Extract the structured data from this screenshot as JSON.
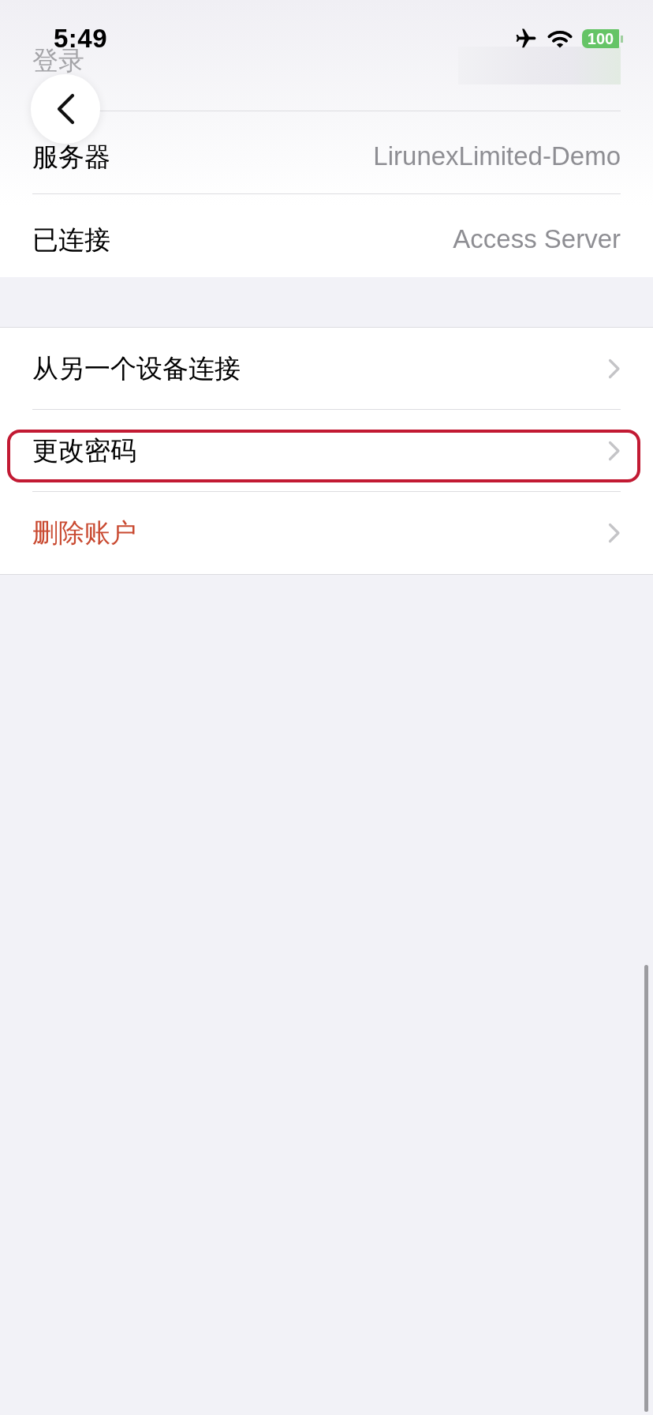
{
  "status_bar": {
    "time": "5:49",
    "airplane_mode": true,
    "battery": "100"
  },
  "account_section": {
    "rows": [
      {
        "label": "登录",
        "faded": true,
        "value_redacted": true
      },
      {
        "label": "服务器",
        "faded": false,
        "value_redacted": false,
        "value": "LirunexLimited-Demo"
      },
      {
        "label": "已连接",
        "faded": false,
        "value_redacted": false,
        "value": "Access Server"
      }
    ]
  },
  "actions_section": {
    "rows": [
      {
        "label": "从另一个设备连接",
        "destructive": false,
        "highlighted": false
      },
      {
        "label": "更改密码",
        "destructive": false,
        "highlighted": true
      },
      {
        "label": "删除账户",
        "destructive": true,
        "highlighted": false
      }
    ]
  }
}
